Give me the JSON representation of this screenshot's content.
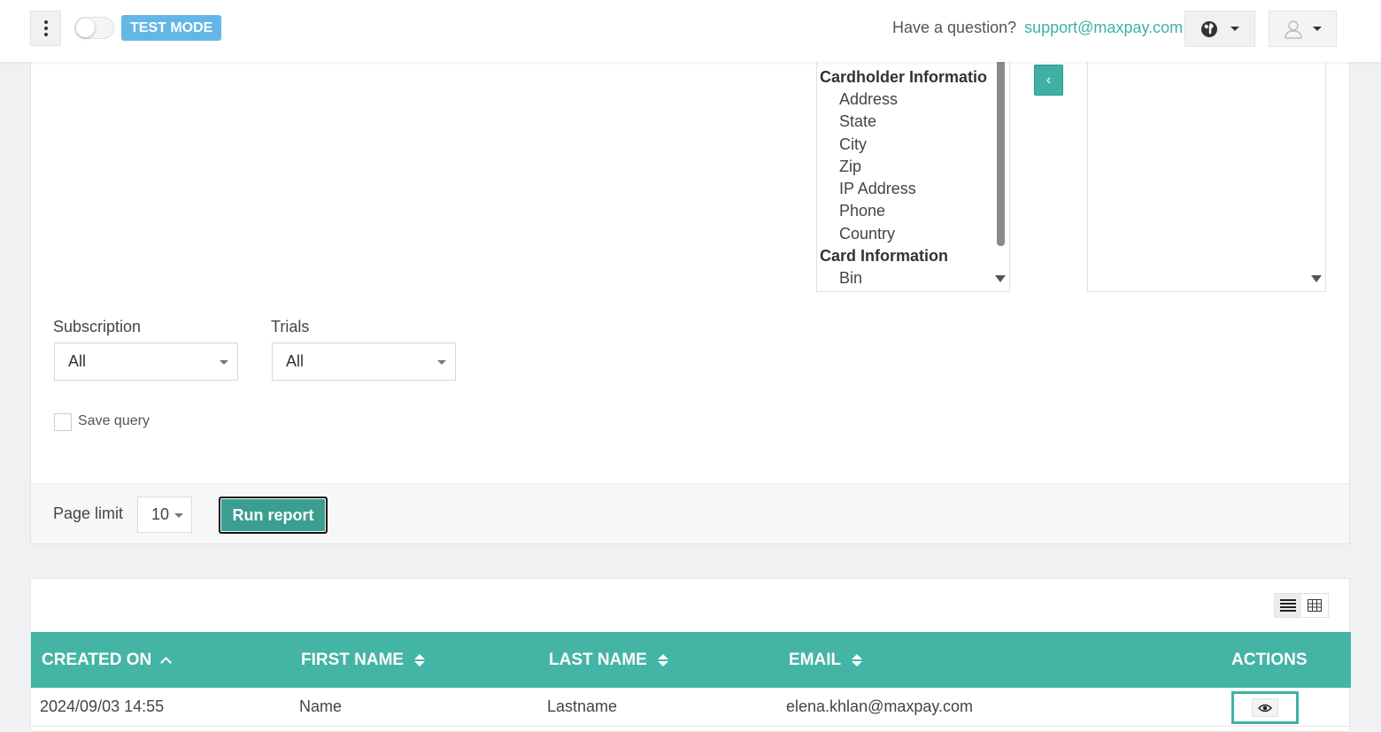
{
  "topbar": {
    "test_mode_label": "TEST MODE",
    "question_text": "Have a question?",
    "support_email": "support@maxpay.com"
  },
  "field_list": {
    "groups": [
      {
        "label": "Cardholder Informatio",
        "options": [
          "Address",
          "State",
          "City",
          "Zip",
          "IP Address",
          "Phone",
          "Country"
        ]
      },
      {
        "label": "Card Information",
        "options": [
          "Bin"
        ]
      }
    ]
  },
  "move_button": {
    "label": "‹"
  },
  "filters": {
    "subscription": {
      "label": "Subscription",
      "value": "All"
    },
    "trials": {
      "label": "Trials",
      "value": "All"
    },
    "save_query_label": "Save query"
  },
  "footer": {
    "page_limit_label": "Page limit",
    "page_limit_value": "10",
    "run_report_label": "Run report"
  },
  "table": {
    "columns": [
      "CREATED ON",
      "FIRST NAME",
      "LAST NAME",
      "EMAIL",
      "ACTIONS"
    ],
    "rows": [
      [
        "2024/09/03 14:55",
        "Name",
        "Lastname",
        "elena.khlan@maxpay.com"
      ]
    ]
  },
  "colors": {
    "accent": "#44b4a5",
    "test_mode": "#63b6e6",
    "link": "#3eb1a4"
  },
  "icons": [
    "vertical-dots-icon",
    "globe-icon",
    "user-icon",
    "list-view-icon",
    "grid-view-icon",
    "eye-icon",
    "sort-icon",
    "chevron-up-icon",
    "chevron-left-icon"
  ]
}
